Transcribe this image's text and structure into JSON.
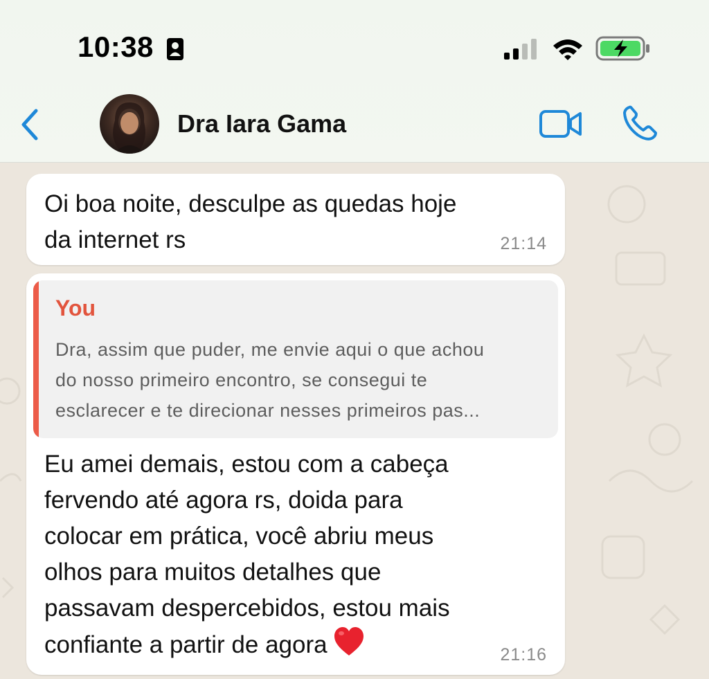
{
  "status_bar": {
    "time": "10:38",
    "icons": [
      "contact-card-icon",
      "cellular-signal-icon",
      "wifi-icon",
      "battery-charging-icon"
    ],
    "battery_color": "#4cd964"
  },
  "chat_header": {
    "contact_name": "Dra Iara Gama",
    "accent_color": "#1e88d8",
    "icons": [
      "back-chevron-icon",
      "video-camera-icon",
      "phone-icon"
    ]
  },
  "messages": [
    {
      "text": "Oi boa noite, desculpe as quedas hoje\nda internet rs",
      "time": "21:14"
    },
    {
      "quote": {
        "author": "You",
        "text": "Dra, assim que puder, me envie aqui o que achou\ndo nosso primeiro encontro, se consegui te\nesclarecer e te direcionar nesses primeiros pas...",
        "accent_color": "#ec5b48"
      },
      "text": "Eu amei demais, estou com a cabeça\nfervendo até agora rs, doida para\ncolocar em prática, você abriu meus\nolhos para muitos detalhes que\npassavam despercebidos, estou mais\nconfiante a partir de agora",
      "emoji": "heart-emoji",
      "time": "21:16"
    }
  ]
}
